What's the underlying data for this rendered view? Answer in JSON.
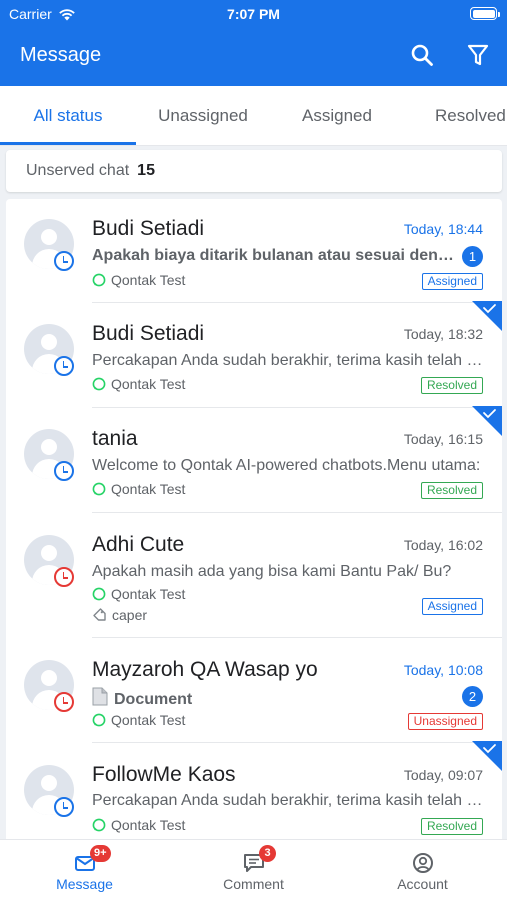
{
  "status_bar": {
    "carrier": "Carrier",
    "time": "7:07 PM"
  },
  "header": {
    "title": "Message",
    "search_icon": "search-icon",
    "filter_icon": "filter-icon"
  },
  "tabs": [
    {
      "label": "All status",
      "active": true
    },
    {
      "label": "Unassigned",
      "active": false
    },
    {
      "label": "Assigned",
      "active": false
    },
    {
      "label": "Resolved",
      "active": false
    }
  ],
  "unserved": {
    "label": "Unserved chat",
    "count": "15"
  },
  "chats": [
    {
      "name": "Budi Setiadi",
      "time": "Today, 18:44",
      "unread": true,
      "preview": "Apakah biaya ditarik bulanan atau sesuai dengan pemakaian?",
      "channel": "Qontak Test",
      "status": "Assigned",
      "badge": "1",
      "clock_color": "blue",
      "resolved_check": false
    },
    {
      "name": "Budi Setiadi",
      "time": "Today, 18:32",
      "unread": false,
      "preview": "Percakapan Anda sudah berakhir, terima kasih telah menghubungi kami.",
      "channel": "Qontak Test",
      "status": "Resolved",
      "clock_color": "blue",
      "resolved_check": true
    },
    {
      "name": "tania",
      "time": "Today, 16:15",
      "unread": false,
      "preview": "Welcome to Qontak AI-powered chatbots.Menu utama:",
      "channel": "Qontak Test",
      "status": "Resolved",
      "clock_color": "blue",
      "resolved_check": true
    },
    {
      "name": "Adhi Cute",
      "time": "Today, 16:02",
      "unread": false,
      "preview": "Apakah masih ada yang bisa kami Bantu Pak/ Bu?",
      "channel": "Qontak Test",
      "tag": "caper",
      "status": "Assigned",
      "clock_color": "red",
      "resolved_check": false
    },
    {
      "name": "Mayzaroh QA Wasap yo",
      "time": "Today, 10:08",
      "unread": true,
      "preview": "Document",
      "preview_icon": "document-icon",
      "channel": "Qontak Test",
      "status": "Unassigned",
      "badge": "2",
      "clock_color": "red",
      "resolved_check": false
    },
    {
      "name": "FollowMe Kaos",
      "time": "Today, 09:07",
      "unread": false,
      "preview": "Percakapan Anda sudah berakhir, terima kasih telah menghubungi kami.",
      "channel": "Qontak Test",
      "status": "Resolved",
      "clock_color": "blue",
      "resolved_check": true
    }
  ],
  "bottom_nav": [
    {
      "label": "Message",
      "badge": "9+",
      "icon": "mail-icon",
      "active": true
    },
    {
      "label": "Comment",
      "badge": "3",
      "icon": "comment-icon",
      "active": false
    },
    {
      "label": "Account",
      "icon": "account-icon",
      "active": false
    }
  ],
  "colors": {
    "primary": "#1a73e8",
    "resolved": "#34a853",
    "unassigned": "#e53935",
    "whatsapp": "#25d366"
  }
}
